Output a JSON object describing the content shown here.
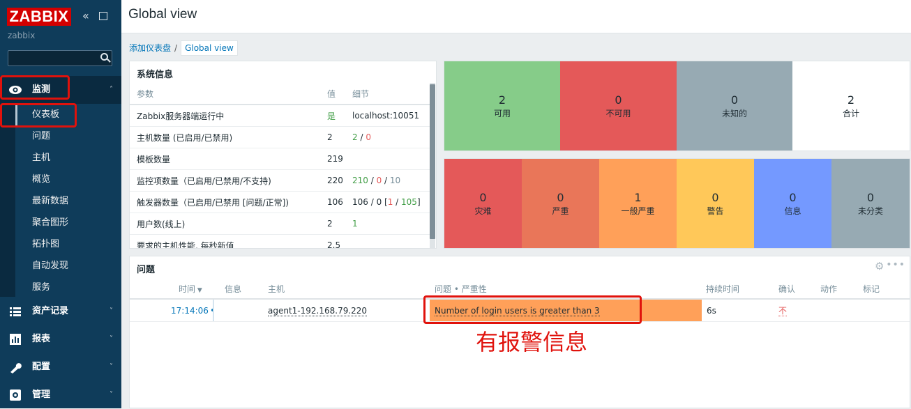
{
  "sidebar": {
    "logo": "ZABBIX",
    "server_name": "zabbix",
    "search_placeholder": "",
    "menu": {
      "monitoring": "监测",
      "inventory": "资产记录",
      "reports": "报表",
      "configuration": "配置",
      "administration": "管理"
    },
    "submenu": [
      "仪表板",
      "问题",
      "主机",
      "概览",
      "最新数据",
      "聚合图形",
      "拓扑图",
      "自动发现",
      "服务"
    ]
  },
  "header": {
    "title": "Global view"
  },
  "breadcrumb": {
    "link": "添加仪表盘",
    "separator": "/",
    "current": "Global view"
  },
  "system_info": {
    "title": "系统信息",
    "columns": [
      "参数",
      "值",
      "细节"
    ],
    "rows": [
      {
        "param": "Zabbix服务器端运行中",
        "value": "是",
        "detail": "localhost:10051"
      },
      {
        "param": "主机数量 (已启用/已禁用)",
        "value": "2",
        "d1": "2",
        "d2": "0"
      },
      {
        "param": "模板数量",
        "value": "219"
      },
      {
        "param": "监控项数量（已启用/已禁用/不支持)",
        "value": "220",
        "d1": "210",
        "d2": "0",
        "d3": "10"
      },
      {
        "param": "触发器数量（已启用/已禁用 [问题/正常])",
        "value": "106",
        "d_prefix": "106 / 0 [",
        "d1": "1",
        "d_mid": " / ",
        "d2": "105",
        "d_suffix": "]"
      },
      {
        "param": "用户数(线上)",
        "value": "2",
        "d1": "1"
      },
      {
        "param": "要求的主机性能, 每秒新值",
        "value": "2.5"
      }
    ],
    "sep": " / "
  },
  "host_availability": [
    {
      "count": "2",
      "label": "可用",
      "color": "#86cc89"
    },
    {
      "count": "0",
      "label": "不可用",
      "color": "#e45959"
    },
    {
      "count": "0",
      "label": "未知的",
      "color": "#97aab3"
    },
    {
      "count": "2",
      "label": "合计",
      "color": "#ffffff"
    }
  ],
  "severity": [
    {
      "count": "0",
      "label": "灾难",
      "color": "#e45959"
    },
    {
      "count": "0",
      "label": "严重",
      "color": "#e97659"
    },
    {
      "count": "1",
      "label": "一般严重",
      "color": "#ffa059"
    },
    {
      "count": "0",
      "label": "警告",
      "color": "#ffc859"
    },
    {
      "count": "0",
      "label": "信息",
      "color": "#7499ff"
    },
    {
      "count": "0",
      "label": "未分类",
      "color": "#97aab3"
    }
  ],
  "problems": {
    "title": "问题",
    "columns": {
      "time": "时间",
      "info": "信息",
      "host": "主机",
      "problem": "问题 • 严重性",
      "duration": "持续时间",
      "ack": "确认",
      "actions": "动作",
      "tags": "标记"
    },
    "rows": [
      {
        "time": "17:14:06",
        "host": "agent1-192.168.79.220",
        "problem": "Number of login users is greater than 3",
        "duration": "6s",
        "ack": "不"
      }
    ]
  },
  "annotation": "有报警信息"
}
